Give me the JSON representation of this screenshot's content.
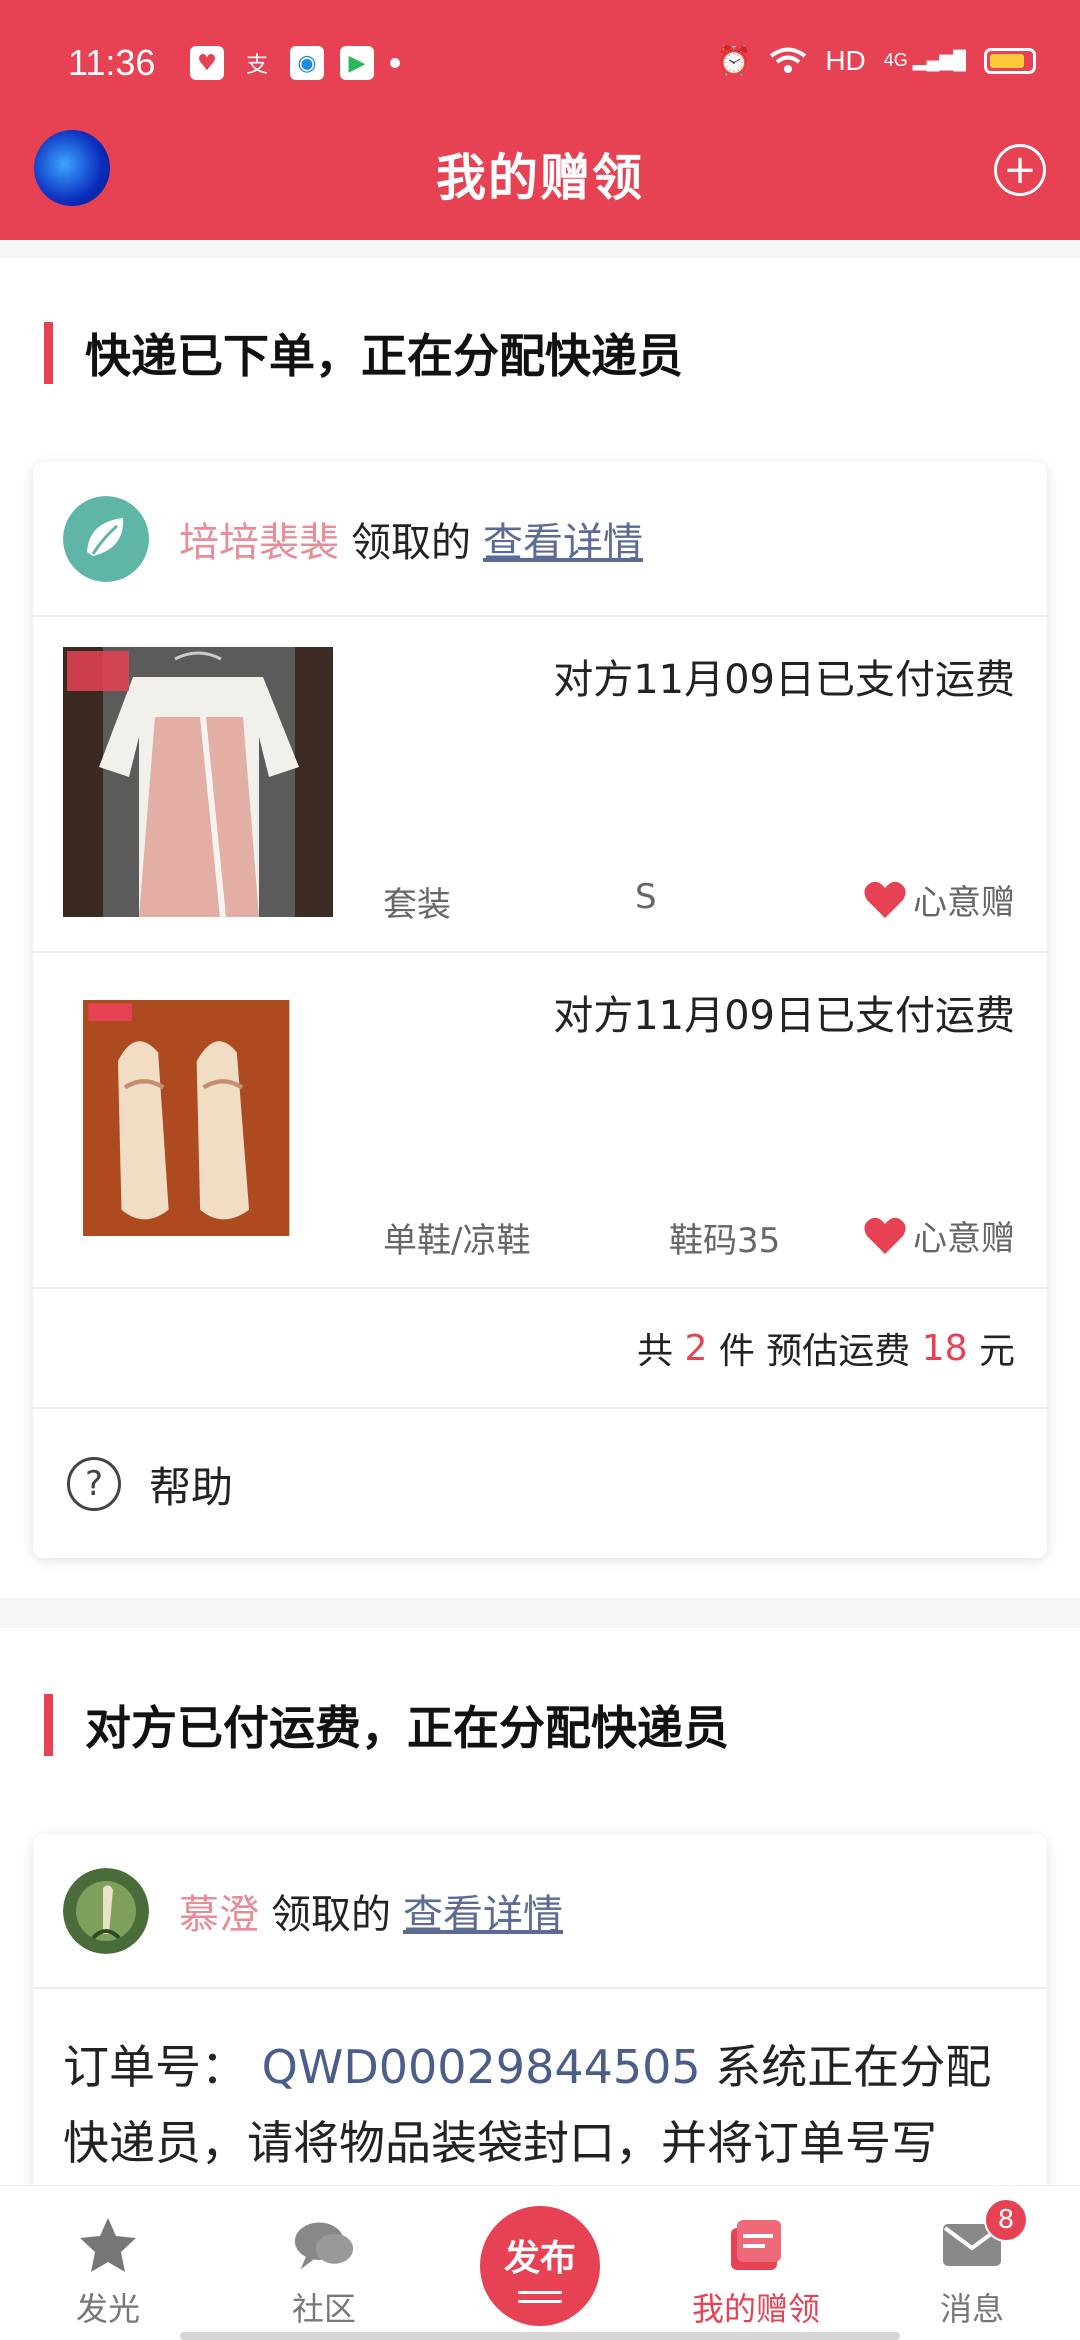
{
  "status_bar": {
    "time": "11:36",
    "network": "HD",
    "signal": "4G"
  },
  "header": {
    "title": "我的赠领",
    "add_icon": "plus-circle-icon"
  },
  "sections": [
    {
      "title": "快递已下单，正在分配快递员",
      "user": "培培裴裴",
      "received_text": "领取的",
      "detail_link": "查看详情",
      "items": [
        {
          "payment": "对方11月09日已支付运费",
          "category": "套装",
          "size": "S",
          "tag": "心意赠"
        },
        {
          "payment": "对方11月09日已支付运费",
          "category": "单鞋/凉鞋",
          "size": "鞋码35",
          "tag": "心意赠"
        }
      ],
      "summary": {
        "prefix": "共 ",
        "count": "2",
        "middle": " 件 预估运费 ",
        "fee": "18",
        "suffix": " 元"
      },
      "help": "帮助"
    },
    {
      "title": "对方已付运费，正在分配快递员",
      "user": "慕澄",
      "received_text": "领取的",
      "detail_link": "查看详情",
      "order_label": "订单号：",
      "order_no": "QWD00029844505",
      "order_text": "系统正在分配快递员，请将物品装袋封口，并将订单号写"
    }
  ],
  "bottom_nav": [
    {
      "label": "发光",
      "icon": "star-icon"
    },
    {
      "label": "社区",
      "icon": "chat-bubble-icon"
    },
    {
      "label": "发布",
      "icon": "publish-icon"
    },
    {
      "label": "我的赠领",
      "icon": "gift-box-icon",
      "active": true
    },
    {
      "label": "消息",
      "icon": "mail-icon",
      "badge": "8"
    }
  ],
  "colors": {
    "accent": "#e64253",
    "username": "#e88d96",
    "link": "#5b6b95"
  }
}
